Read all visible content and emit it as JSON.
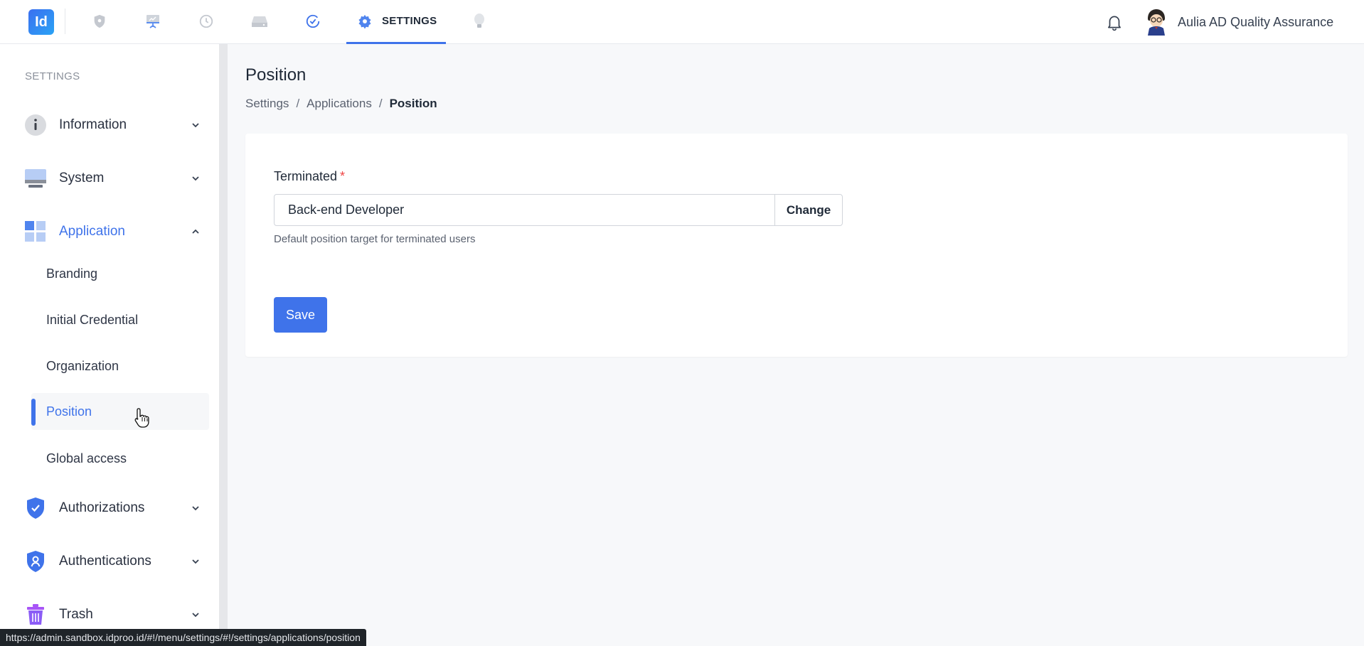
{
  "topbar": {
    "logo_text": "Id",
    "nav_icons": [
      "shield-icon",
      "presentation-icon",
      "history-icon",
      "server-icon",
      "check-circle-icon",
      "bulb-icon"
    ],
    "active_tab_label": "SETTINGS",
    "active_tab_icon": "gear-icon",
    "user_name": "Aulia AD Quality Assurance"
  },
  "sidebar": {
    "heading": "SETTINGS",
    "groups": [
      {
        "label": "Information",
        "icon": "info-icon",
        "expanded": false
      },
      {
        "label": "System",
        "icon": "monitor-icon",
        "expanded": false
      },
      {
        "label": "Application",
        "icon": "grid-icon",
        "expanded": true
      },
      {
        "label": "Authorizations",
        "icon": "shield-check-icon",
        "expanded": false
      },
      {
        "label": "Authentications",
        "icon": "shield-user-icon",
        "expanded": false
      },
      {
        "label": "Trash",
        "icon": "trash-icon",
        "expanded": false
      }
    ],
    "application_items": [
      "Branding",
      "Initial Credential",
      "Organization",
      "Position",
      "Global access"
    ],
    "active_item": "Position"
  },
  "main": {
    "title": "Position",
    "breadcrumb": [
      "Settings",
      "Applications",
      "Position"
    ],
    "breadcrumb_sep": "/",
    "field": {
      "label": "Terminated",
      "required_mark": "*",
      "value": "Back-end Developer",
      "change_label": "Change",
      "help": "Default position target for terminated users"
    },
    "save_label": "Save"
  },
  "statusbar": {
    "url": "https://admin.sandbox.idproo.id/#!/menu/settings/#!/settings/applications/position"
  },
  "colors": {
    "accent": "#3f73ea",
    "required": "#ef4444"
  }
}
